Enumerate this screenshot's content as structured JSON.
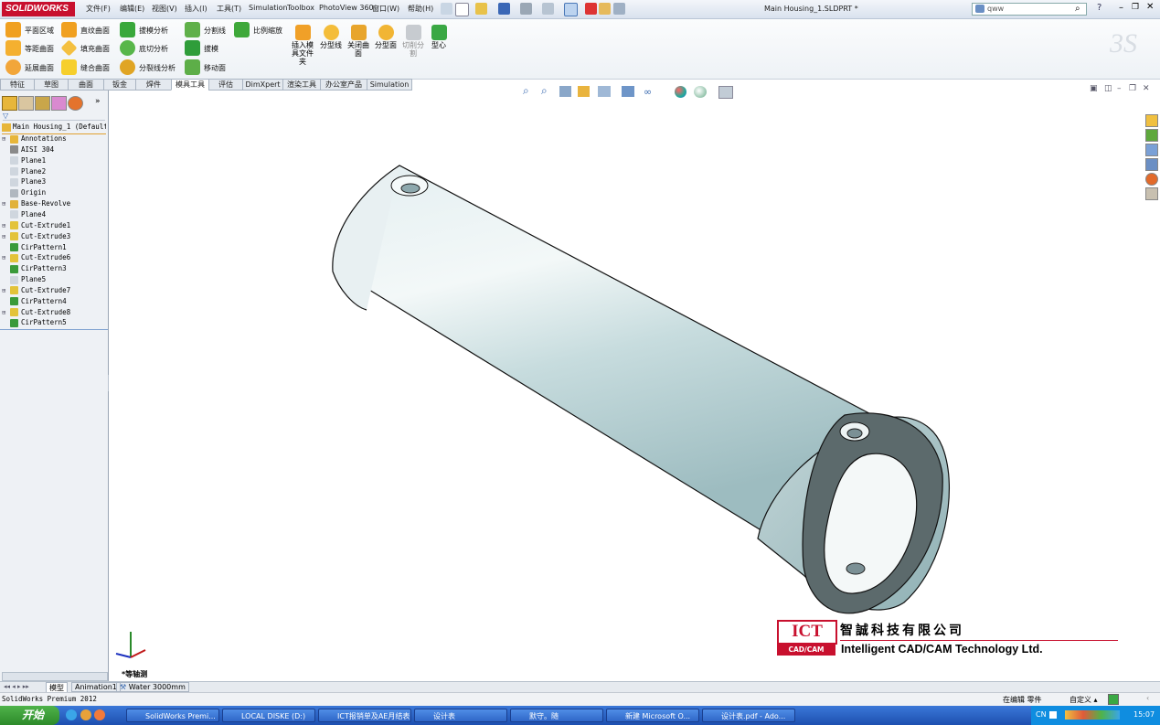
{
  "app": {
    "brand": "SOLIDWORKS",
    "title": "Main Housing_1.SLDPRT *"
  },
  "menu": [
    "文件(F)",
    "编辑(E)",
    "视图(V)",
    "插入(I)",
    "工具(T)",
    "Simulation",
    "Toolbox",
    "PhotoView 360",
    "窗口(W)",
    "帮助(H)"
  ],
  "search": {
    "value": "qww"
  },
  "ribbon": {
    "col1": [
      "平面区域",
      "等距曲面",
      "延展曲面"
    ],
    "col2": [
      "直纹曲面",
      "填充曲面",
      "缝合曲面"
    ],
    "col3": [
      "拔模分析",
      "底切分析",
      "分裂线分析"
    ],
    "col4": [
      "分割线",
      "拔模",
      "移动面"
    ],
    "scale": "比例缩放",
    "insert_mold": "插入模具文件夹",
    "parting_line": "分型线",
    "shut_off": "关闭曲面",
    "parting_surface": "分型面",
    "tooling_split": "切削分割",
    "core": "型心"
  },
  "tabs": [
    "特征",
    "草图",
    "曲面",
    "钣金",
    "焊件",
    "模具工具",
    "评估",
    "DimXpert",
    "渲染工具",
    "办公室产品",
    "Simulation"
  ],
  "active_tab": "模具工具",
  "tree": {
    "root": "Main Housing_1  (Default<",
    "items": [
      "Annotations",
      "AISI 304",
      "Plane1",
      "Plane2",
      "Plane3",
      "Origin",
      "Base-Revolve",
      "Plane4",
      "Cut-Extrude1",
      "Cut-Extrude3",
      "CirPattern1",
      "Cut-Extrude6",
      "CirPattern3",
      "Plane5",
      "Cut-Extrude7",
      "CirPattern4",
      "Cut-Extrude8",
      "CirPattern5"
    ]
  },
  "view_label": "*等轴测",
  "watermark": {
    "logo": "ICT",
    "sub": "CAD/CAM",
    "cn": "智誠科技有限公司",
    "en": "Intelligent CAD/CAM Technology Ltd."
  },
  "bottom_tabs": [
    "模型",
    "Animation1",
    "Water 3000mm"
  ],
  "status": {
    "left": "SolidWorks Premium 2012",
    "editing": "在编辑 零件",
    "custom": "自定义"
  },
  "taskbar": {
    "start": "开始",
    "items": [
      "SolidWorks Premi...",
      "LOCAL DISKE (D:)",
      "ICT报销单及AE月结表",
      "设计表",
      "默守。随",
      "新建 Microsoft O...",
      "设计表.pdf - Ado..."
    ],
    "lang": "CN",
    "clock": "15:07"
  },
  "colors": {
    "brand": "#c8102e",
    "taskbar": "#245edb",
    "part": "#c9dfe2"
  }
}
